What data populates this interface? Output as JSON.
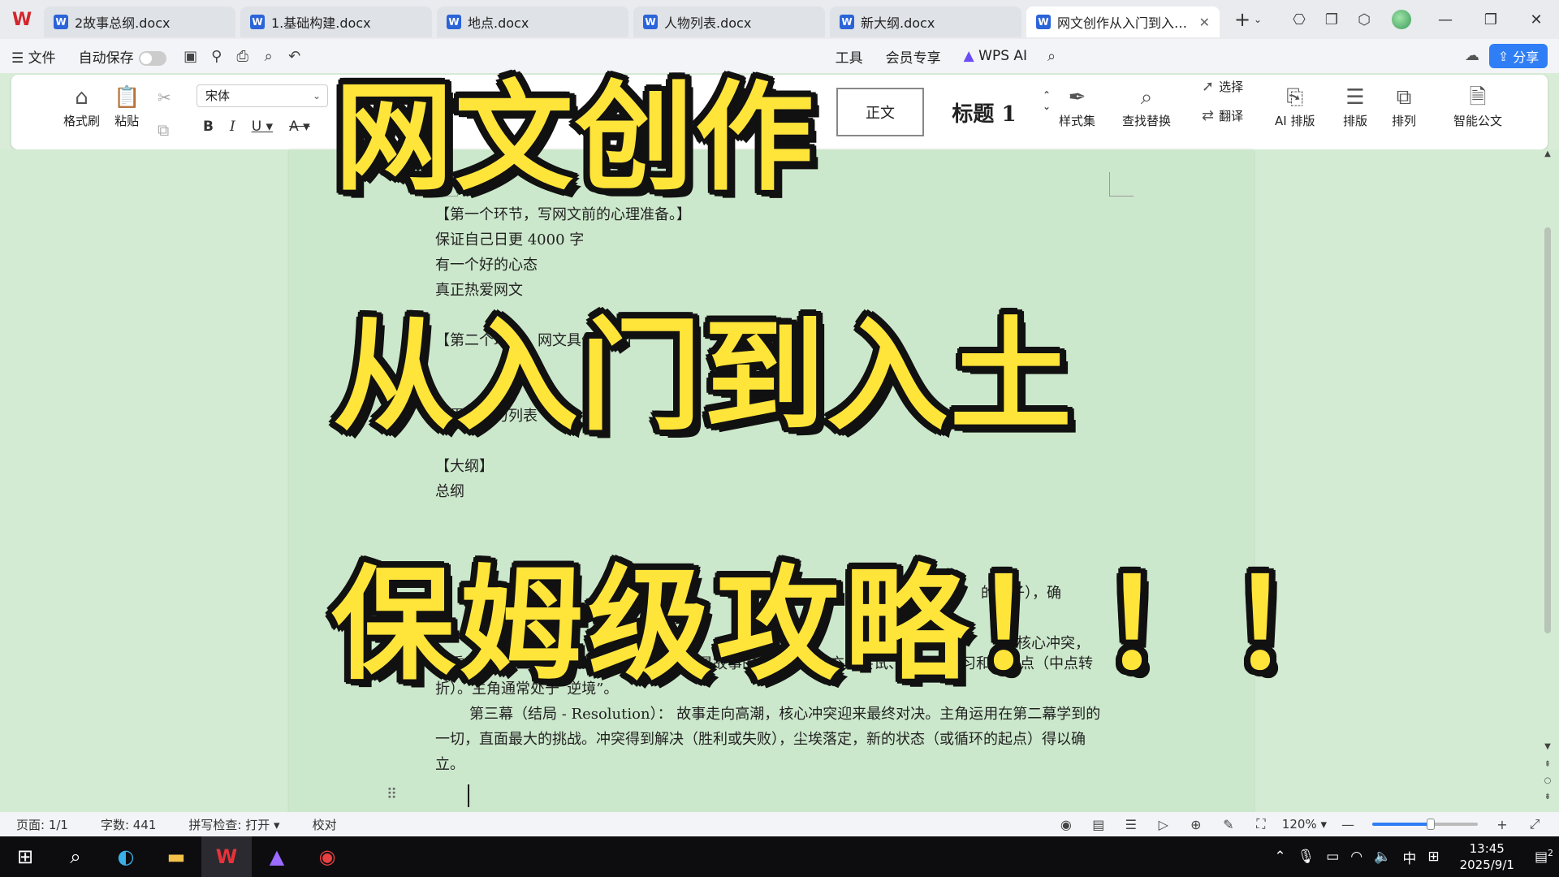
{
  "tabs": [
    {
      "label": "2故事总纲.docx",
      "active": false
    },
    {
      "label": "1.基础构建.docx",
      "active": false
    },
    {
      "label": "地点.docx",
      "active": false
    },
    {
      "label": "人物列表.docx",
      "active": false
    },
    {
      "label": "新大纲.docx",
      "active": false
    },
    {
      "label": "网文创作从入门到入土·保",
      "active": true
    }
  ],
  "menu": {
    "file": "文件",
    "autosave": "自动保存",
    "tools": "工具",
    "vip": "会员专享",
    "wps_ai": "WPS AI",
    "share": "分享"
  },
  "ribbon": {
    "format_painter": "格式刷",
    "paste": "粘贴",
    "font_name": "宋体",
    "style_normal": "正文",
    "style_heading": "标题 1",
    "style_set": "样式集",
    "find_replace": "查找替换",
    "select": "选择",
    "translate": "翻译",
    "ai_layout": "AI 排版",
    "layout": "排版",
    "arrange": "排列",
    "smart_doc": "智能公文"
  },
  "document": {
    "lines": [
      "【第一个环节，写网文前的心理准备。】",
      "保证自己日更 4000 字",
      "有一个好的心态",
      "真正热爱网文",
      "【第二个环节，网文具体创作】",
      "世界观势力列表",
      "【大纲】",
      "总纲"
    ],
    "para_act2_tail": "临重重阻碍、不断升级的挑战和风险。这是故事的主体部分，充满尝试、失败、学习和转折点（中点转折）。主角通常处于“逆境”。",
    "para_act3": "第三幕（结局 - Resolution）：  故事走向高潮，核心冲突迎来最终对决。主角运用在第二幕学到的一切，直面最大的挑战。冲突得到解决（胜利或失败），尘埃落定，新的状态（或循环的起点）得以确立。",
    "fragment_seed": "的种子），确",
    "fragment_conflict": "核心冲突，"
  },
  "overlay": {
    "line1": "网文创作",
    "line2": "从入门到入土",
    "line3": "保姆级攻略！！！"
  },
  "status": {
    "page": "页面: 1/1",
    "words": "字数: 441",
    "spell": "拼写检查: 打开",
    "proof": "校对",
    "zoom": "120%",
    "zoom_level": 0.55
  },
  "taskbar": {
    "ime": "中",
    "time": "13:45",
    "date": "2025/9/1",
    "notifications": "2"
  },
  "colors": {
    "doc_bg": "#cce8cc",
    "overlay_fill": "#ffe43a",
    "overlay_stroke": "#111111",
    "accent": "#2f7ef5",
    "wps_red": "#d3262c"
  }
}
